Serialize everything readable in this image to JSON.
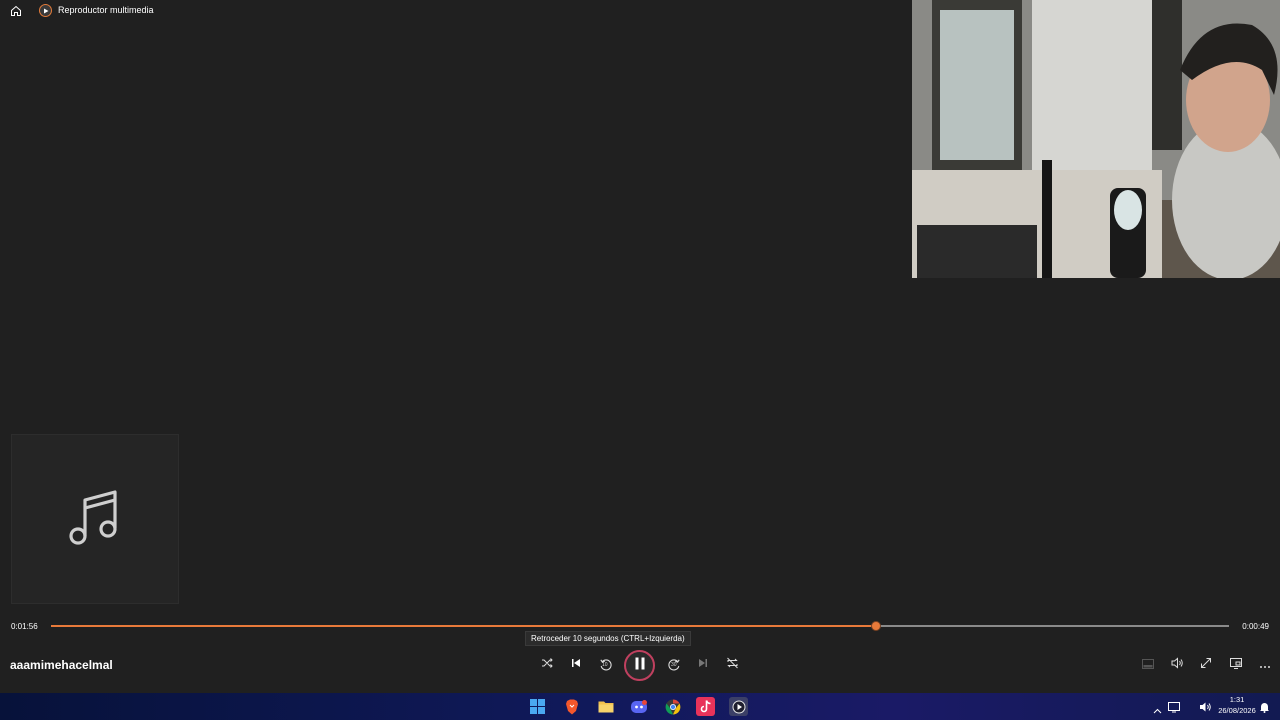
{
  "app": {
    "title": "Reproductor multimedia"
  },
  "player": {
    "track_title": "aaamimehacelmal",
    "elapsed": "0:01:56",
    "remaining": "0:00:49",
    "progress": 0.7,
    "tooltip": "Retroceder 10 segundos (CTRL+Izquierda)",
    "skip_back_label": "10",
    "skip_forward_label": "30"
  },
  "icons": {
    "home": "home-icon",
    "app": "media-player-icon",
    "album_placeholder": "music-note-icon",
    "shuffle": "shuffle-icon",
    "previous": "previous-icon",
    "skip_back": "skip-back-10-icon",
    "pause": "pause-icon",
    "skip_forward": "skip-forward-30-icon",
    "next": "next-icon",
    "repeat": "repeat-off-icon",
    "miniplayer": "miniplayer-icon",
    "volume": "volume-icon",
    "fullscreen": "fullscreen-icon",
    "cast": "cast-icon",
    "more": "more-icon"
  },
  "taskbar": {
    "apps": [
      "windows-start-icon",
      "brave-browser-icon",
      "file-explorer-icon",
      "discord-icon",
      "chrome-icon",
      "tiktok-icon",
      "media-player-icon"
    ],
    "time": "1:31",
    "date": "26/08/2026"
  },
  "colors": {
    "accent": "#e87a3a",
    "background": "#202020"
  }
}
